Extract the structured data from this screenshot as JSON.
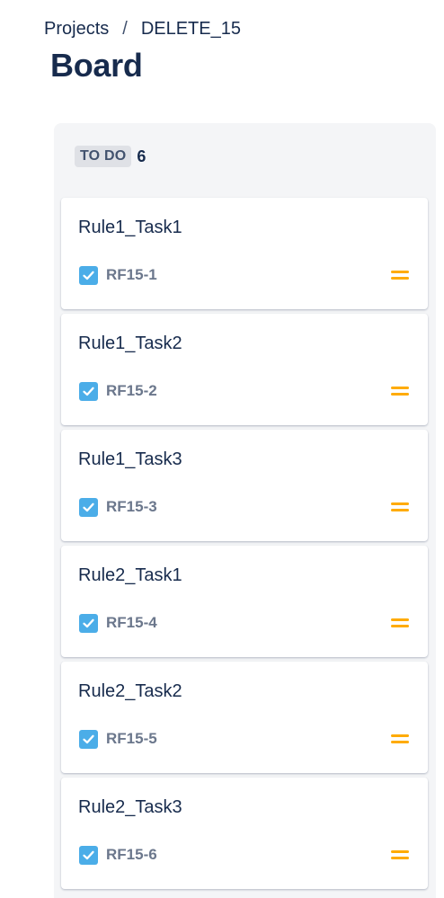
{
  "breadcrumb": {
    "items": [
      "Projects",
      "DELETE_15"
    ],
    "separator": "/"
  },
  "page": {
    "title": "Board"
  },
  "column": {
    "status": "TO DO",
    "count": "6",
    "cards": [
      {
        "title": "Rule1_Task1",
        "key": "RF15-1",
        "type_icon": "task-checkbox-icon",
        "priority_icon": "priority-medium-icon"
      },
      {
        "title": "Rule1_Task2",
        "key": "RF15-2",
        "type_icon": "task-checkbox-icon",
        "priority_icon": "priority-medium-icon"
      },
      {
        "title": "Rule1_Task3",
        "key": "RF15-3",
        "type_icon": "task-checkbox-icon",
        "priority_icon": "priority-medium-icon"
      },
      {
        "title": "Rule2_Task1",
        "key": "RF15-4",
        "type_icon": "task-checkbox-icon",
        "priority_icon": "priority-medium-icon"
      },
      {
        "title": "Rule2_Task2",
        "key": "RF15-5",
        "type_icon": "task-checkbox-icon",
        "priority_icon": "priority-medium-icon"
      },
      {
        "title": "Rule2_Task3",
        "key": "RF15-6",
        "type_icon": "task-checkbox-icon",
        "priority_icon": "priority-medium-icon"
      }
    ]
  },
  "colors": {
    "task_icon": "#4bade8",
    "priority_medium": "#ffab00",
    "column_bg": "#f4f5f7",
    "lozenge_bg": "#dfe1e6"
  }
}
